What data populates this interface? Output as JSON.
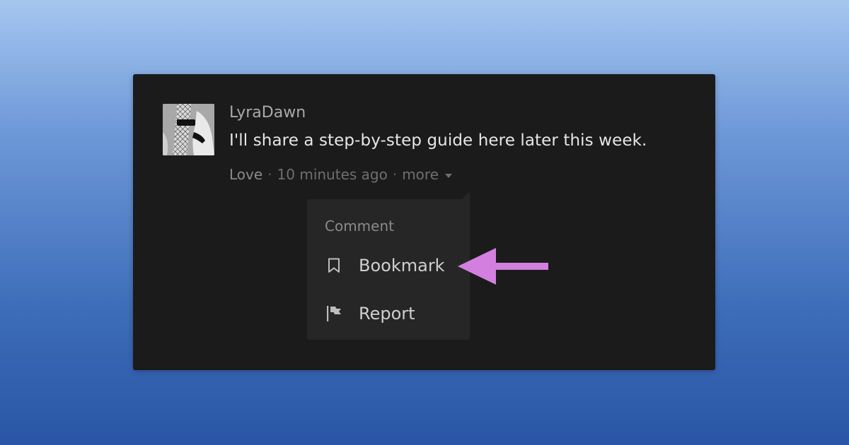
{
  "comment": {
    "username": "LyraDawn",
    "text": "I'll share a step-by-step guide here later this week.",
    "meta": {
      "love_label": "Love",
      "separator": "·",
      "timestamp": "10 minutes ago",
      "more_label": "more"
    }
  },
  "dropdown": {
    "header": "Comment",
    "items": [
      {
        "label": "Bookmark",
        "icon": "bookmark-icon"
      },
      {
        "label": "Report",
        "icon": "flag-icon"
      }
    ]
  },
  "colors": {
    "card_background": "#1b1b1b",
    "dropdown_background": "#262626",
    "arrow_annotation": "#d37fe0"
  }
}
